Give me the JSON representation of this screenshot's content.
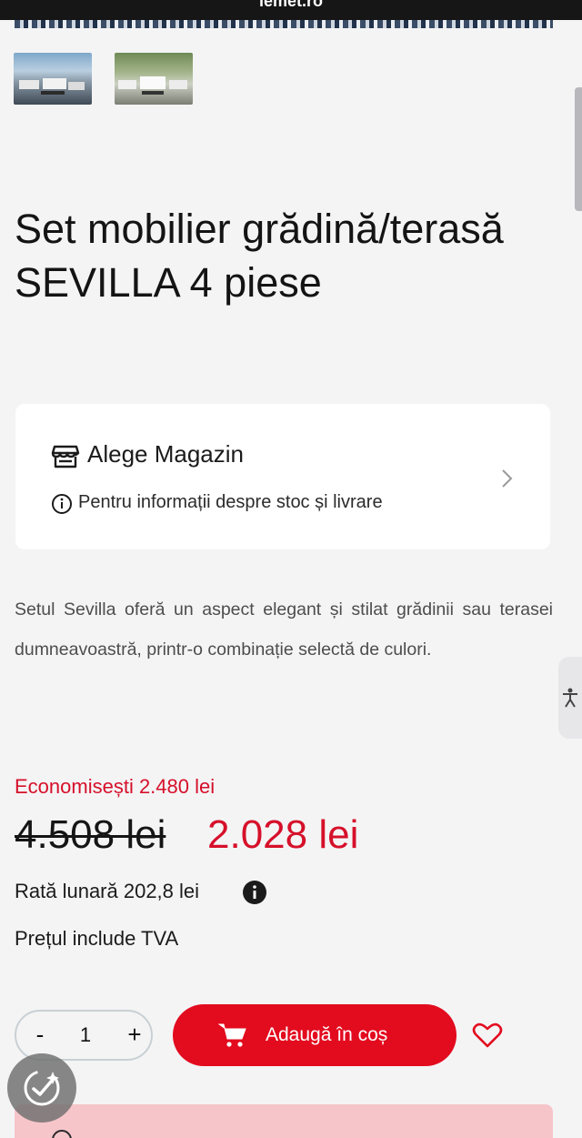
{
  "browser": {
    "url": "lemet.ro"
  },
  "gallery": {
    "thumbnails": [
      {
        "alt": "patio-set-seaside"
      },
      {
        "alt": "patio-set-garden"
      }
    ]
  },
  "product": {
    "title": "Set mobilier grădină/terasă SEVILLA 4 piese",
    "description": "Setul Sevilla oferă un aspect elegant și stilat grădinii sau terasei dumneavoastră, printr-o combinație selectă de culori."
  },
  "store_picker": {
    "title": "Alege Magazin",
    "subtitle": "Pentru informații despre stoc și livrare",
    "icon": "store-icon"
  },
  "pricing": {
    "savings": "Economisești 2.480 lei",
    "old_price": "4.508 lei",
    "new_price": "2.028 lei",
    "monthly_rate": "Rată lunară 202,8 lei",
    "vat_note": "Prețul include TVA"
  },
  "cart": {
    "quantity_minus": "-",
    "quantity": "1",
    "quantity_plus": "+",
    "add_label": "Adaugă în coș"
  },
  "colors": {
    "brand_red": "#e30b1e",
    "price_red": "#d6102a",
    "background": "#f4f4f5"
  }
}
